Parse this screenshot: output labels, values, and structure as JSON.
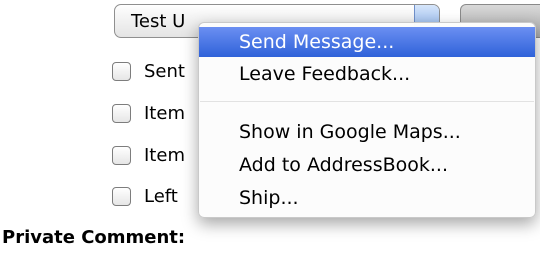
{
  "popup": {
    "value": "Test U"
  },
  "checkboxes": [
    {
      "label": "Sent",
      "checked": false
    },
    {
      "label": "Item",
      "checked": false
    },
    {
      "label": "Item",
      "checked": false
    },
    {
      "label": "Left",
      "checked": false
    }
  ],
  "private_comment_label": "Private Comment:",
  "menu": {
    "items": [
      {
        "label": "Send Message...",
        "selected": true
      },
      {
        "label": "Leave Feedback...",
        "selected": false
      },
      {
        "label": "Show in Google Maps...",
        "selected": false
      },
      {
        "label": "Add to AddressBook...",
        "selected": false
      },
      {
        "label": "Ship...",
        "selected": false
      }
    ]
  },
  "colors": {
    "selection": "#3a6ee0",
    "selection_text": "#ffffff"
  }
}
